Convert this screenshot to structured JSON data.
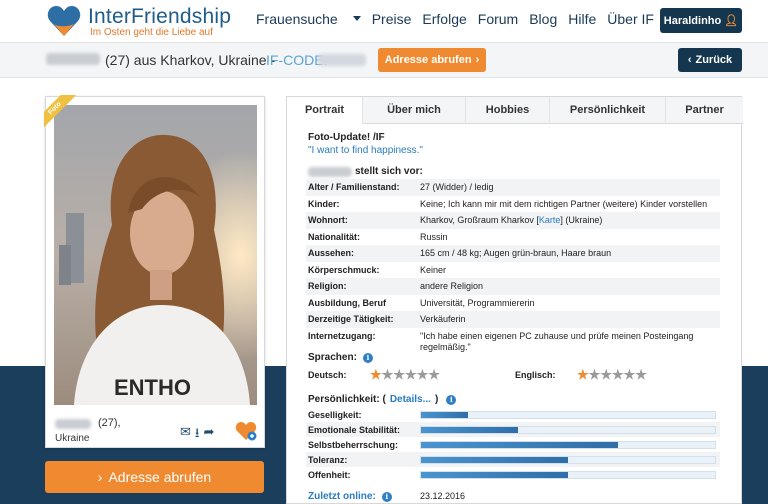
{
  "header": {
    "logo_name": "InterFriendship",
    "logo_tagline": "Im Osten geht die Liebe auf",
    "nav": [
      "Frauensuche",
      "Preise",
      "Erfolge",
      "Forum",
      "Blog",
      "Hilfe",
      "Über IF"
    ],
    "user_button": "Haraldinho"
  },
  "profile_bar": {
    "name_suffix": "(27) aus Kharkov, Ukraine -",
    "code_label": "IF-CODE:",
    "address_button": "Adresse abrufen",
    "back_button": "Zurück"
  },
  "photo_card": {
    "ribbon": "Foto",
    "age_text": "(27),",
    "city": "Ukraine",
    "address_button": "Adresse abrufen"
  },
  "tabs": [
    "Portrait",
    "Über mich",
    "Hobbies",
    "Persönlichkeit",
    "Partner"
  ],
  "portrait": {
    "photo_update_title": "Foto-Update! /IF",
    "photo_update_quote": "\"I want to find happiness.\"",
    "intro": "stellt sich vor:",
    "facts": [
      {
        "k": "Alter / Familienstand:",
        "v": "27 (Widder) / ledig"
      },
      {
        "k": "Kinder:",
        "v": "Keine; Ich kann mir mit dem richtigen Partner (weitere) Kinder vorstellen"
      },
      {
        "k": "Wohnort:",
        "v_pre": "Kharkov, Großraum Kharkov [",
        "v_link": "Karte",
        "v_post": "] (Ukraine)"
      },
      {
        "k": "Nationalität:",
        "v": "Russin"
      },
      {
        "k": "Aussehen:",
        "v": "165 cm / 48 kg; Augen grün-braun, Haare braun"
      },
      {
        "k": "Körperschmuck:",
        "v": "Keiner"
      },
      {
        "k": "Religion:",
        "v": "andere Religion"
      },
      {
        "k": "Ausbildung, Beruf",
        "v": "Universität, Programmiererin"
      },
      {
        "k": "Derzeitige Tätigkeit:",
        "v": "Verkäuferin"
      },
      {
        "k": "Internetzugang:",
        "v": "\"Ich habe einen eigenen PC zuhause und prüfe meinen Posteingang regelmäßig.\""
      }
    ],
    "languages_title": "Sprachen:",
    "languages": [
      {
        "name": "Deutsch:",
        "stars": 1,
        "max": 6
      },
      {
        "name": "Englisch:",
        "stars": 1,
        "max": 6
      }
    ],
    "personality_title": "Persönlichkeit: (",
    "personality_link": "Details...",
    "personality_close": ")",
    "traits": [
      {
        "name": "Geselligkeit:",
        "value": 0.16
      },
      {
        "name": "Emotionale Stabilität:",
        "value": 0.33
      },
      {
        "name": "Selbstbeherrschung:",
        "value": 0.67
      },
      {
        "name": "Toleranz:",
        "value": 0.5
      },
      {
        "name": "Offenheit:",
        "value": 0.5
      }
    ],
    "last_online_label": "Zuletzt online:",
    "last_online_date": "23.12.2016"
  },
  "colors": {
    "brand_dark": "#15364f",
    "accent_orange": "#f08a30",
    "link_blue": "#2a7bc0"
  }
}
